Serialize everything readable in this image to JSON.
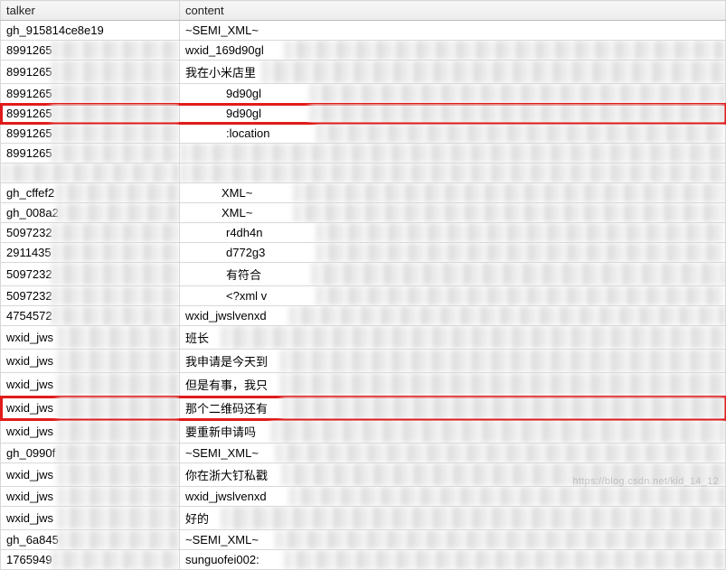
{
  "headers": {
    "talker": "talker",
    "content": "content"
  },
  "rows": [
    {
      "talker": "gh_915814ce8e19",
      "content": "~SEMI_XML~",
      "t_blur_from": null,
      "c_blur_from": null,
      "hl": false
    },
    {
      "talker": "8991265",
      "content": "wxid_169d90gl",
      "t_blur_from": 55,
      "c_blur_from": 115,
      "hl": false
    },
    {
      "talker": "8991265",
      "content": "我在小米店里",
      "t_blur_from": 55,
      "c_blur_from": 90,
      "hl": false
    },
    {
      "talker": "8991265",
      "content": "9d90gl",
      "t_blur_from": 55,
      "c_blur_from": 98,
      "hl": false,
      "c_prepad": 45
    },
    {
      "talker": "8991265",
      "content": "9d90gl",
      "t_blur_from": 55,
      "c_blur_from": 98,
      "hl": true,
      "c_prepad": 45
    },
    {
      "talker": "8991265",
      "content": ":location",
      "t_blur_from": 55,
      "c_blur_from": 105,
      "hl": false,
      "c_prepad": 45
    },
    {
      "talker": "8991265",
      "content": "",
      "t_blur_from": 55,
      "c_blur_from": 0,
      "hl": false
    },
    {
      "talker": "",
      "content": "",
      "t_blur_from": 0,
      "c_blur_from": 0,
      "hl": false
    },
    {
      "talker": "gh_cffef2",
      "content": "XML~",
      "t_blur_from": 60,
      "c_blur_from": 85,
      "hl": false,
      "c_prepad": 40
    },
    {
      "talker": "gh_008a2",
      "content": "XML~",
      "t_blur_from": 60,
      "c_blur_from": 85,
      "hl": false,
      "c_prepad": 40
    },
    {
      "talker": "5097232",
      "content": "r4dh4n",
      "t_blur_from": 55,
      "c_blur_from": 105,
      "hl": false,
      "c_prepad": 45
    },
    {
      "talker": "2911435",
      "content": "d772g3",
      "t_blur_from": 55,
      "c_blur_from": 105,
      "hl": false,
      "c_prepad": 45
    },
    {
      "talker": "5097232",
      "content": "有符合",
      "t_blur_from": 55,
      "c_blur_from": 100,
      "hl": false,
      "c_prepad": 45
    },
    {
      "talker": "5097232",
      "content": "<?xml v",
      "t_blur_from": 55,
      "c_blur_from": 105,
      "hl": false,
      "c_prepad": 45
    },
    {
      "talker": "4754572",
      "content": "wxid_jwslvenxd",
      "t_blur_from": 55,
      "c_blur_from": 120,
      "hl": false
    },
    {
      "talker": "wxid_jws",
      "content": "班长",
      "t_blur_from": 62,
      "c_blur_from": 45,
      "hl": false
    },
    {
      "talker": "wxid_jws",
      "content": "我申请是今天到",
      "t_blur_from": 62,
      "c_blur_from": 110,
      "hl": false
    },
    {
      "talker": "wxid_jws",
      "content": "但是有事，我只",
      "t_blur_from": 62,
      "c_blur_from": 110,
      "hl": false
    },
    {
      "talker": "wxid_jws",
      "content": "那个二维码还有",
      "t_blur_from": 62,
      "c_blur_from": 112,
      "hl": true
    },
    {
      "talker": "wxid_jws",
      "content": "要重新申请吗",
      "t_blur_from": 62,
      "c_blur_from": 100,
      "hl": false
    },
    {
      "talker": "gh_0990f",
      "content": "~SEMI_XML~",
      "t_blur_from": 60,
      "c_blur_from": 105,
      "hl": false
    },
    {
      "talker": "wxid_jws",
      "content": "你在浙大钉私戳",
      "t_blur_from": 62,
      "c_blur_from": 112,
      "hl": false
    },
    {
      "talker": "wxid_jws",
      "content": "wxid_jwslvenxd",
      "t_blur_from": 62,
      "c_blur_from": 120,
      "hl": false
    },
    {
      "talker": "wxid_jws",
      "content": "好的",
      "t_blur_from": 62,
      "c_blur_from": 45,
      "hl": false
    },
    {
      "talker": "gh_6a845",
      "content": "~SEMI_XML~",
      "t_blur_from": 62,
      "c_blur_from": 105,
      "hl": false
    },
    {
      "talker": "1765949",
      "content": "sunguofei002:",
      "t_blur_from": 55,
      "c_blur_from": 115,
      "hl": false
    }
  ],
  "watermark": "https://blog.csdn.net/kid_14_12"
}
